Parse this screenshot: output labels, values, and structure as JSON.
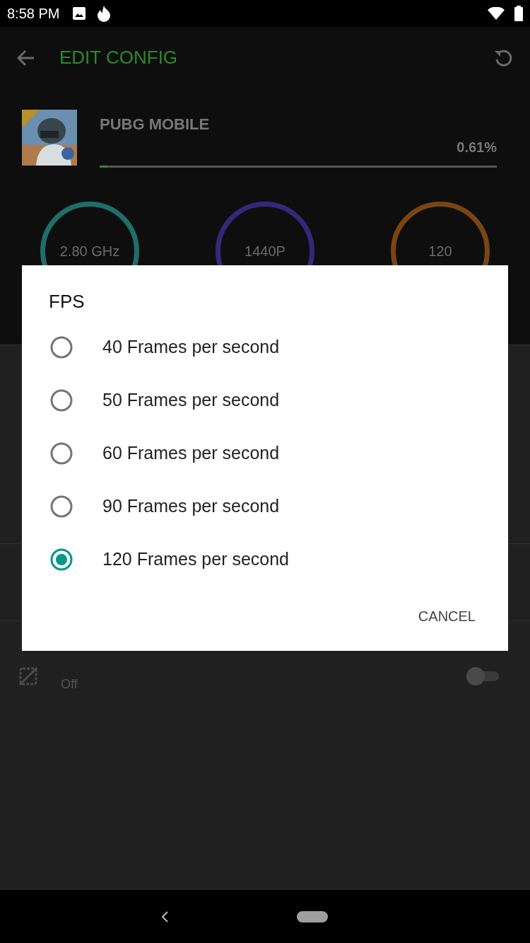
{
  "status_bar": {
    "time": "8:58 PM"
  },
  "app_bar": {
    "title": "EDIT CONFIG"
  },
  "game": {
    "name": "PUBG MOBILE",
    "usage": "0.61%",
    "level": 0.02
  },
  "gauges": [
    {
      "value": "2.80 GHz",
      "color": "#1f6e6a"
    },
    {
      "value": "1440P",
      "color": "#33287a"
    },
    {
      "value": "120",
      "color": "#7a4512"
    }
  ],
  "settings": [
    {
      "subtitle": "Off",
      "on": false
    }
  ],
  "dialog": {
    "title": "FPS",
    "options": [
      {
        "label": "40 Frames per second",
        "selected": false
      },
      {
        "label": "50 Frames per second",
        "selected": false
      },
      {
        "label": "60 Frames per second",
        "selected": false
      },
      {
        "label": "90 Frames per second",
        "selected": false
      },
      {
        "label": "120 Frames per second",
        "selected": true
      }
    ],
    "buttons": [
      "CANCEL"
    ]
  }
}
